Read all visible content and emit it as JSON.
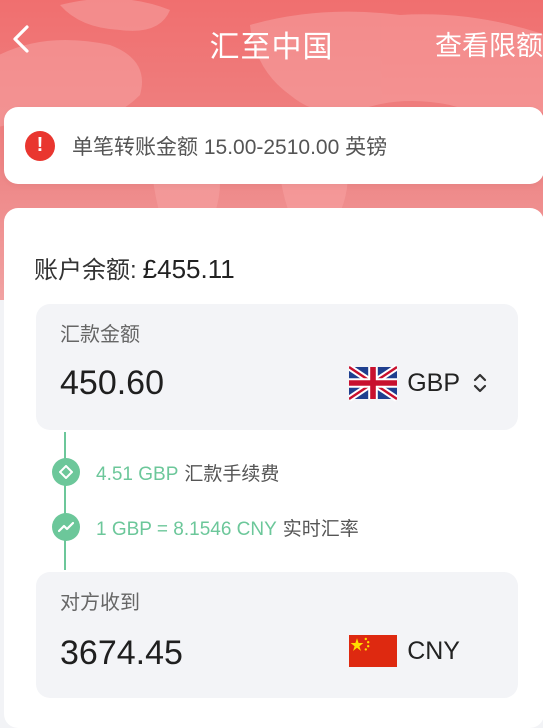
{
  "header": {
    "title": "汇至中国",
    "right_link": "查看限额"
  },
  "notice": {
    "text": "单笔转账金额 15.00-2510.00 英镑"
  },
  "balance": {
    "label": "账户余额:",
    "value": "£455.11"
  },
  "send": {
    "label": "汇款金额",
    "amount": "450.60",
    "currency": "GBP"
  },
  "details": {
    "fee_value": "4.51 GBP",
    "fee_label": "汇款手续费",
    "rate_value": "1 GBP = 8.1546 CNY",
    "rate_label": "实时汇率"
  },
  "receive": {
    "label": "对方收到",
    "amount": "3674.45",
    "currency": "CNY"
  },
  "colors": {
    "brand_red": "#f06f6f",
    "alert_red": "#e9362f",
    "green": "#6cc79a"
  },
  "icons": {
    "back": "chevron-left-icon",
    "alert": "exclamation-circle-icon",
    "fee": "diamond-icon",
    "rate": "trend-icon",
    "sort": "up-down-arrows-icon",
    "gbp_flag": "uk-flag-icon",
    "cny_flag": "china-flag-icon"
  }
}
